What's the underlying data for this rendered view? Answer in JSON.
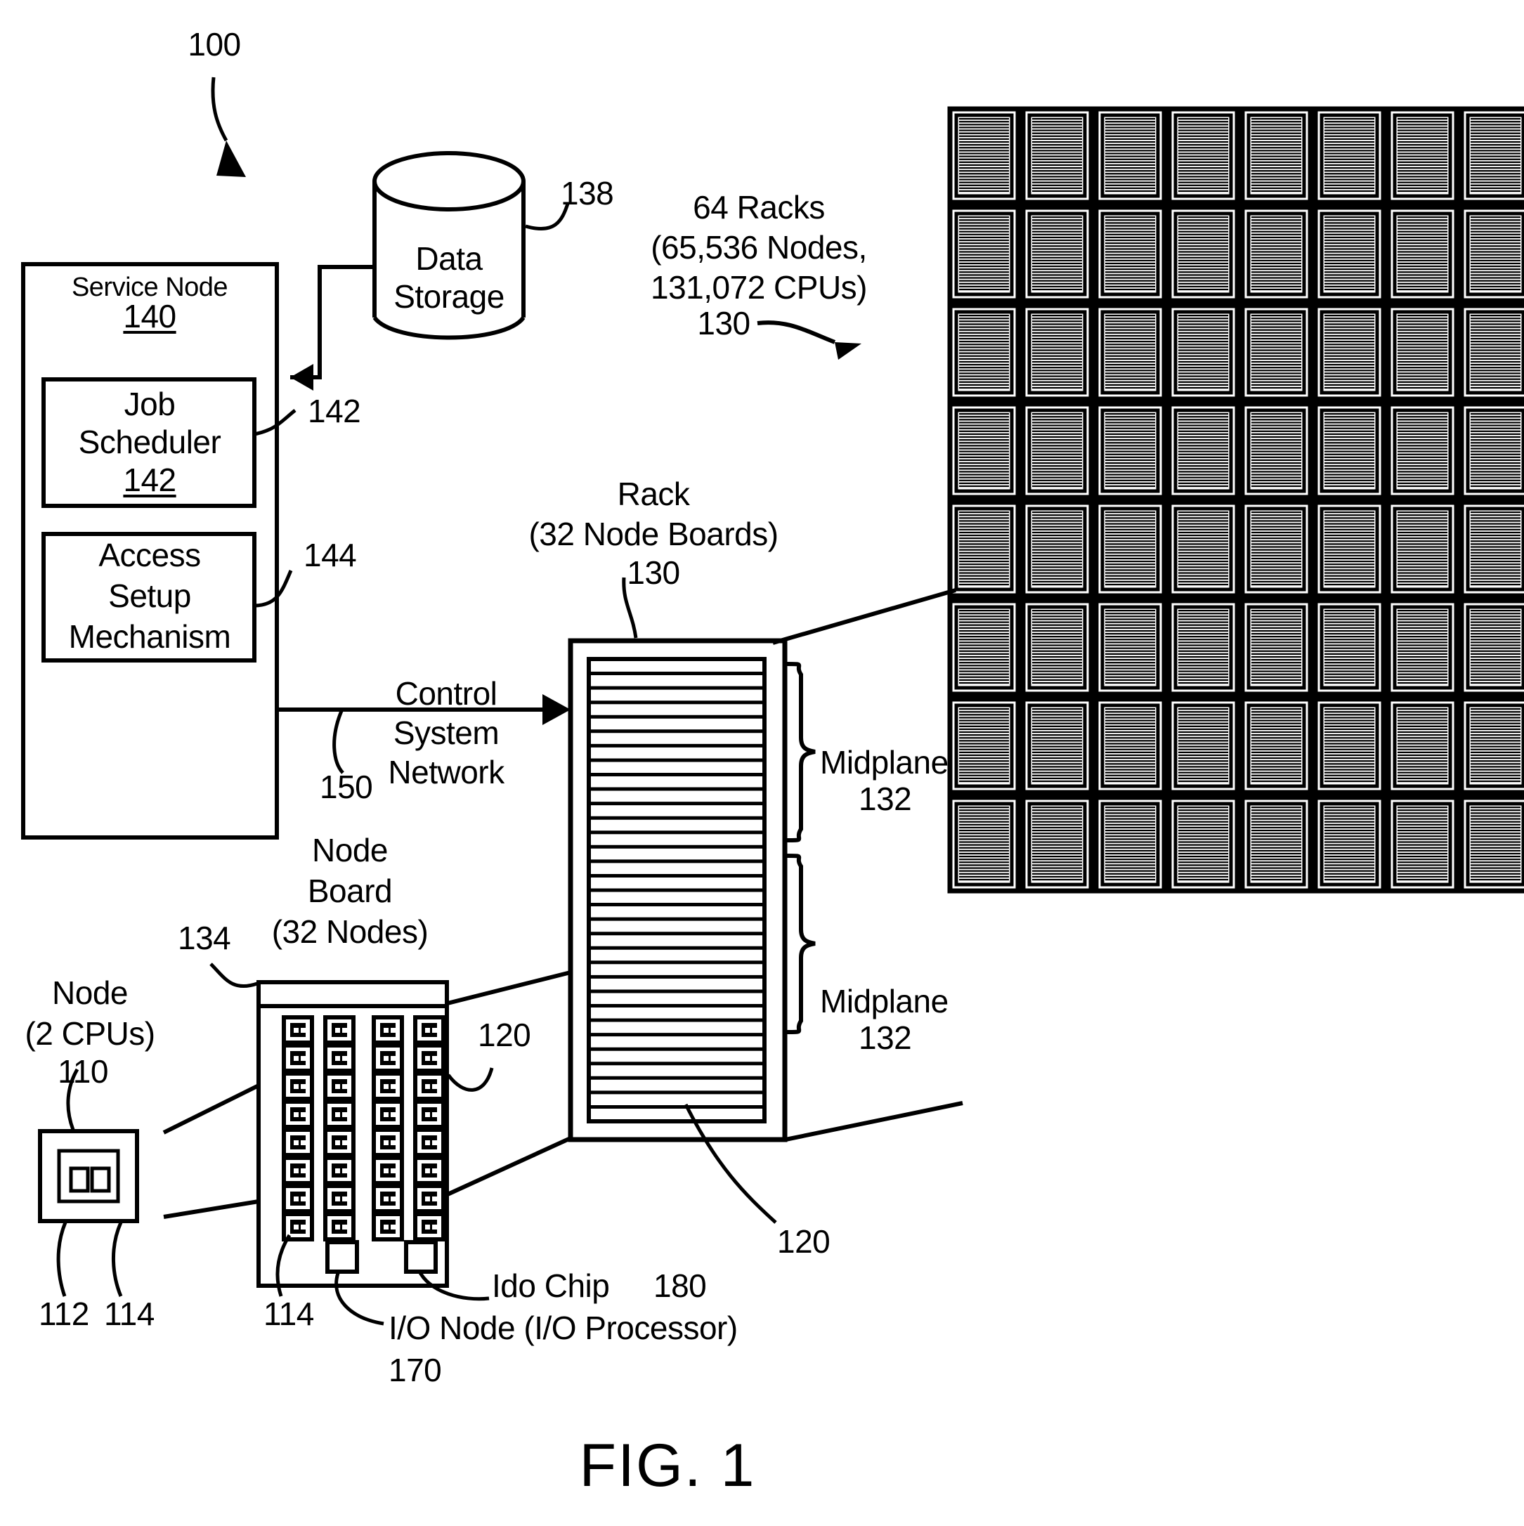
{
  "figure": {
    "caption": "FIG. 1",
    "system_ref": "100"
  },
  "service_node": {
    "title": "Service Node",
    "ref": "140",
    "job_scheduler": {
      "title_line1": "Job",
      "title_line2": "Scheduler",
      "ref": "142"
    },
    "access_setup": {
      "line1": "Access",
      "line2": "Setup",
      "line3": "Mechanism"
    },
    "job_scheduler_leader_ref": "142",
    "access_setup_leader_ref": "144"
  },
  "data_storage": {
    "line1": "Data",
    "line2": "Storage",
    "ref": "138"
  },
  "control_network": {
    "line1": "Control",
    "line2": "System",
    "line3": "Network",
    "ref": "150"
  },
  "racks_summary": {
    "line1": "64 Racks",
    "line2": "(65,536 Nodes,",
    "line3": "131,072 CPUs)",
    "ref": "130",
    "columns": 8,
    "rows": 8,
    "total": 64
  },
  "rack": {
    "line1": "Rack",
    "line2": "(32 Node Boards)",
    "ref": "130",
    "node_board_slots": 32,
    "midplane_upper": {
      "label": "Midplane",
      "ref": "132"
    },
    "midplane_lower": {
      "label": "Midplane",
      "ref": "132"
    },
    "node_board_ref_upper": "120",
    "node_board_ref_lower": "120"
  },
  "node_board": {
    "line1": "Node",
    "line2": "Board",
    "line3": "(32 Nodes)",
    "ref": "134",
    "node_ref": "114",
    "node_columns": 4,
    "node_rows": 8,
    "node_count": 32,
    "io_node": {
      "label": "I/O Node (I/O Processor)",
      "ref": "170"
    },
    "ido_chip": {
      "label": "Ido Chip",
      "ref": "180"
    }
  },
  "node": {
    "line1": "Node",
    "line2": "(2 CPUs)",
    "ref": "110",
    "cpu_ref": "112",
    "chip_ref": "114",
    "cpu_count": 2
  },
  "colors": {
    "ink": "#000000",
    "paper": "#ffffff"
  }
}
